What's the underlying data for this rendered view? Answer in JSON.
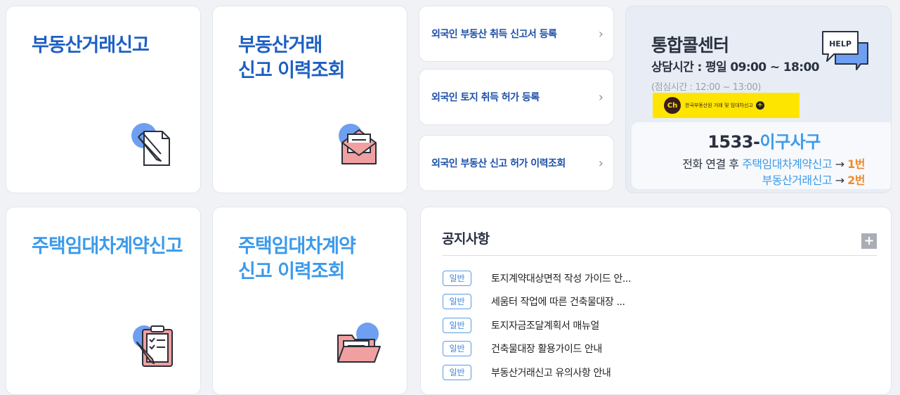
{
  "tiles": {
    "realestate_report": "부동산거래신고",
    "realestate_history": "부동산거래\n신고 이력조회",
    "lease_report": "주택임대차계약신고",
    "lease_history": "주택임대차계약\n신고 이력조회"
  },
  "links": [
    {
      "label": "외국인 부동산 취득 신고서 등록"
    },
    {
      "label": "외국인 토지 취득 허가 등록"
    },
    {
      "label": "외국인 부동산 신고 허가 이력조회"
    }
  ],
  "chevron": "›",
  "callcenter": {
    "title": "통합콜센터",
    "hours": "상담시간 : 평일 09:00 ~ 18:00",
    "lunch": "(점심시간 : 12:00 ~ 13:00)",
    "help_text": "HELP",
    "kakao_ch": "Ch",
    "kakao_text": "한국부동산원 거래 및 임대차신고",
    "kakao_plus": "+",
    "phone_num": "1533-",
    "phone_word": "이구사구",
    "line1_prefix": "전화 연결 후 ",
    "line1_service": "주택임대차계약신고",
    "line1_arrow": " → ",
    "line1_num": "1번",
    "line2_service": "부동산거래신고",
    "line2_arrow": " → ",
    "line2_num": "2번"
  },
  "notice": {
    "title": "공지사항",
    "more": "+",
    "items": [
      {
        "badge": "일반",
        "text": "토지계약대상면적 작성 가이드 안..."
      },
      {
        "badge": "일반",
        "text": "세움터 작업에 따른 건축물대장 ..."
      },
      {
        "badge": "일반",
        "text": "토지자금조달계획서 매뉴얼"
      },
      {
        "badge": "일반",
        "text": "건축물대장 활용가이드 안내"
      },
      {
        "badge": "일반",
        "text": "부동산거래신고 유의사항 안내"
      }
    ]
  },
  "colors": {
    "dark_blue": "#1d5fc4",
    "light_blue": "#3c9aea",
    "orange": "#f08a2a",
    "icon_bubble": "#6e9ff0",
    "icon_pink": "#f0a0a0"
  }
}
